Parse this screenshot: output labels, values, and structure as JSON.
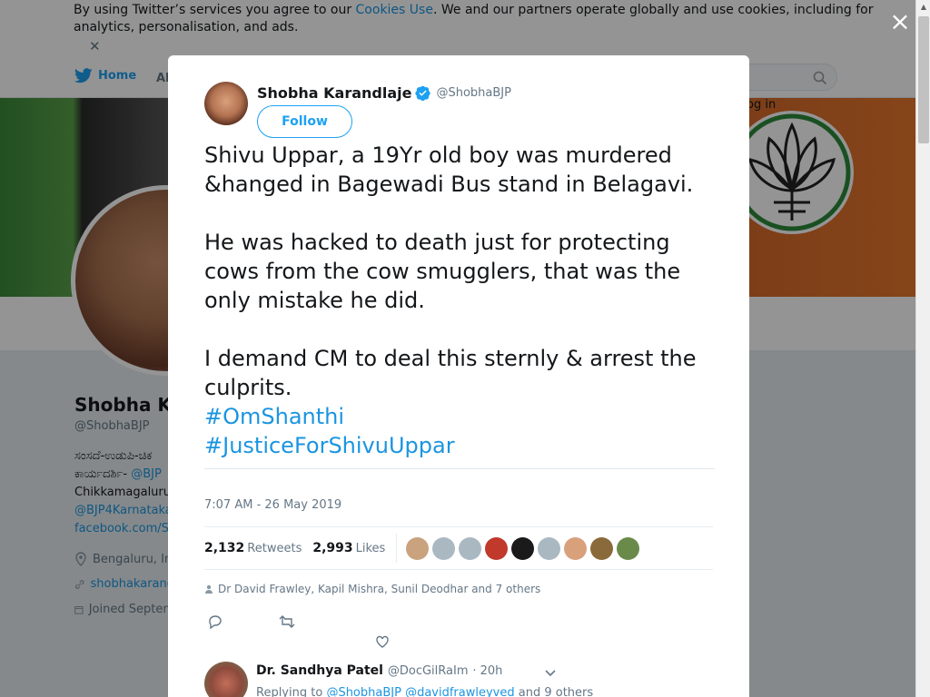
{
  "cookie_bar": {
    "text_before": "By using Twitter’s services you agree to our ",
    "link": "Cookies Use",
    "text_after": ". We and our partners operate globally and use cookies, including for analytics, personalisation, and ads.",
    "close": "✕"
  },
  "nav": {
    "home": "Home",
    "about": "Ab",
    "login": "og in"
  },
  "profile_bg": {
    "name": "Shobha Ka",
    "handle": "@ShobhaBJP",
    "bio_line1": "ಸಂಸದೆ-ಉಡುಪಿ-ಚಿಕ",
    "bio_line2_text": "ಕಾರ್ಯದರ್ಶಿ- ",
    "bio_line2_link": "@BJP",
    "bio_line3": "Chikkamagaluru",
    "bio_line4_link": "@BJP4Karnataka",
    "bio_line5_link": "facebook.com/Sh",
    "location": "Bengaluru, In",
    "website": "shobhakarand",
    "joined": "Joined Septem"
  },
  "modal": {
    "close": "×",
    "author": {
      "name": "Shobha Karandlaje",
      "handle": "@ShobhaBJP",
      "verified": true
    },
    "follow_label": "Follow",
    "tweet": {
      "para1": "Shivu Uppar, a 19Yr old boy was murdered &hanged in Bagewadi Bus stand in Belagavi.",
      "para2": "He was hacked to death just for protecting cows from the cow smugglers, that was the only mistake he did.",
      "para3": "I demand CM to deal this sternly & arrest the culprits.",
      "hashtag1": "#OmShanthi",
      "hashtag2": "#JusticeForShivuUppar"
    },
    "timestamp": "7:07 AM - 26 May 2019",
    "stats": {
      "retweets_count": "2,132",
      "retweets_label": "Retweets",
      "likes_count": "2,993",
      "likes_label": "Likes"
    },
    "liked_by": "Dr David Frawley, Kapil Mishra, Sunil Deodhar and 7 others",
    "reply": {
      "name": "Dr. Sandhya Patel",
      "handle": "@DocGilRaIm",
      "time": "20h",
      "replying_prefix": "Replying to ",
      "replying_link1": "@ShobhaBJP",
      "replying_link2": "@davidfrawleyved",
      "replying_suffix": " and 9 others"
    }
  },
  "colors": {
    "twitter_blue": "#1da1f2",
    "link_blue": "#1b95e0",
    "text_gray": "#657786"
  }
}
